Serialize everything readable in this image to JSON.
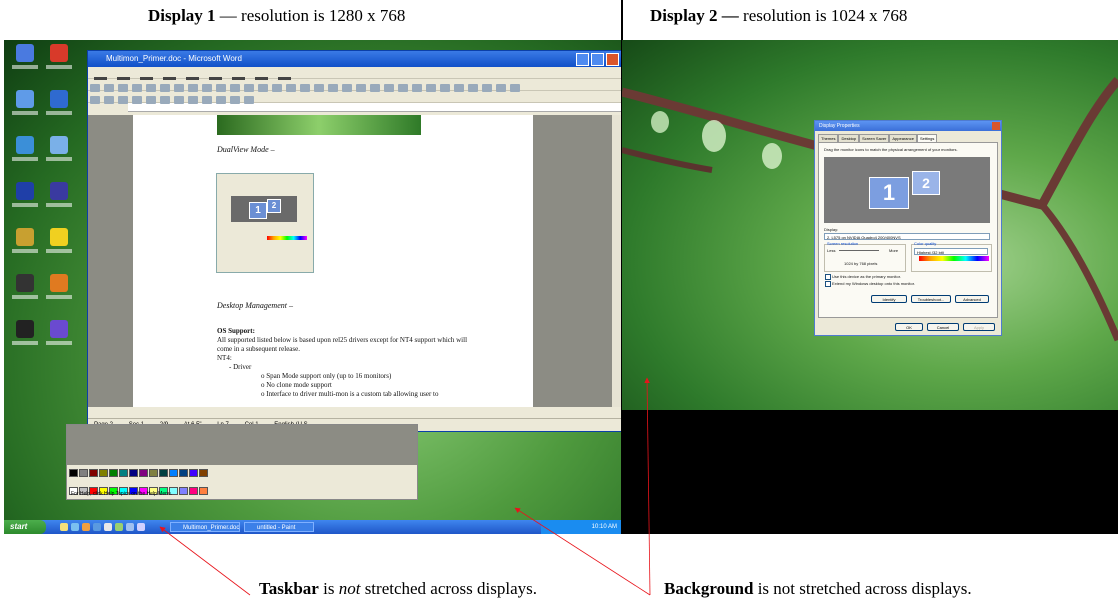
{
  "headings": {
    "display1": {
      "bold": "Display 1",
      "rest": " — resolution is 1280 x 768"
    },
    "display2": {
      "bold": "Display 2 —",
      "rest": " resolution is 1024 x 768"
    }
  },
  "captions": {
    "taskbar": {
      "bold": "Taskbar",
      "mid": " is ",
      "italic": "not",
      "rest": " stretched across displays."
    },
    "background": {
      "bold": "Background",
      "rest": " is not stretched across displays."
    }
  },
  "display1": {
    "word_window": {
      "title": "Multimon_Primer.doc - Microsoft Word",
      "document": {
        "heading_dualview": "DualView Mode –",
        "heading_desktop": "Desktop Management –",
        "os_support_label": "OS Support:",
        "os_line1": "All supported listed below is based upon rel25 drivers except for NT4 support which will",
        "os_line2": "come in a subsequent release.",
        "nt4": "NT4:",
        "bullet_driver": "-    Driver",
        "sub1": "o   Span Mode support only (up to 16 monitors)",
        "sub2": "o   No clone mode support",
        "sub3": "o   Interface to driver multi-mon is a custom tab allowing user to"
      },
      "status": {
        "page": "Page 2",
        "sec": "Sec 1",
        "pos": "2/9",
        "at": "At 6.5\"",
        "ln": "Ln 7",
        "col": "Col 1",
        "lang": "English (U.S"
      }
    },
    "paint_window": {
      "status": "For Help, click Help Topics on the Help Menu."
    },
    "taskbar": {
      "start": "start",
      "buttons": [
        "Multimon_Primer.doc ...",
        "untitled - Paint"
      ],
      "clock": "10:10 AM"
    }
  },
  "display2": {
    "dialog": {
      "title": "Display Properties",
      "tabs": [
        "Themes",
        "Desktop",
        "Screen Saver",
        "Appearance",
        "Settings"
      ],
      "instruction": "Drag the monitor icons to match the physical arrangement of your monitors.",
      "display_label": "Display:",
      "display_value": "2. L575 on NVIDIA Quadro4 200/400NVS",
      "resolution_label": "Screen resolution",
      "less": "Less",
      "more": "More",
      "resolution_value": "1024 by 768 pixels",
      "color_label": "Color quality",
      "color_value": "Highest (32 bit)",
      "check_primary": "Use this device as the primary monitor.",
      "check_extend": "Extend my Windows desktop onto this monitor.",
      "buttons": {
        "identify": "Identify",
        "troubleshoot": "Troubleshoot...",
        "advanced": "Advanced",
        "ok": "OK",
        "cancel": "Cancel",
        "apply": "Apply"
      }
    },
    "monitors": [
      "1",
      "2"
    ]
  },
  "colors": {
    "arrow": "#e8141b",
    "xp_blue": "#245edb",
    "start_green": "#3c9a3c"
  }
}
